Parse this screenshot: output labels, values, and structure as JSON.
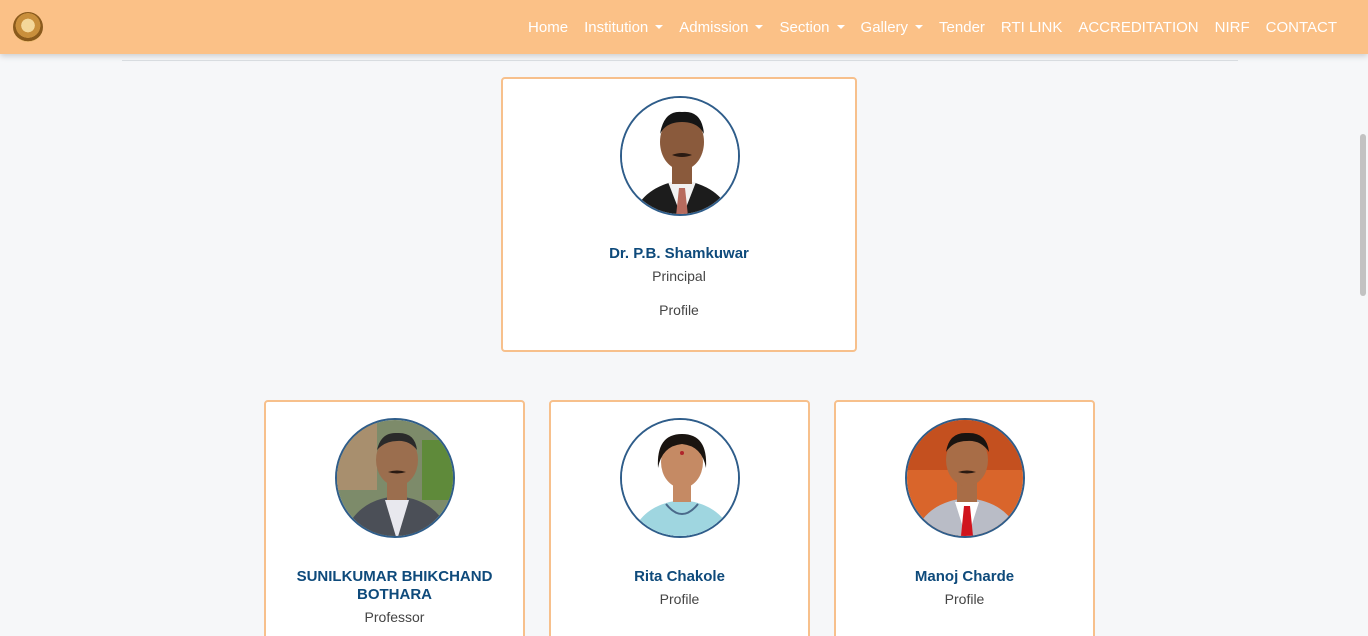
{
  "nav": {
    "items": [
      {
        "label": "Home",
        "dropdown": false
      },
      {
        "label": "Institution",
        "dropdown": true
      },
      {
        "label": "Admission",
        "dropdown": true
      },
      {
        "label": "Section",
        "dropdown": true
      },
      {
        "label": "Gallery",
        "dropdown": true
      },
      {
        "label": "Tender",
        "dropdown": false
      },
      {
        "label": "RTI LINK",
        "dropdown": false
      },
      {
        "label": "ACCREDITATION",
        "dropdown": false
      },
      {
        "label": "NIRF",
        "dropdown": false
      },
      {
        "label": "CONTACT",
        "dropdown": false
      }
    ]
  },
  "principal": {
    "name": "Dr. P.B. Shamkuwar",
    "role": "Principal",
    "link": "Profile"
  },
  "staff": [
    {
      "name": "SUNILKUMAR BHIKCHAND BOTHARA",
      "role": "Professor"
    },
    {
      "name": "Rita Chakole",
      "role": "Profile"
    },
    {
      "name": "Manoj Charde",
      "role": "Profile"
    }
  ],
  "colors": {
    "navbar": "#fbc187",
    "card_border": "#f7c08c",
    "name": "#0e4a7b",
    "photo_border": "#2f5d8a"
  }
}
